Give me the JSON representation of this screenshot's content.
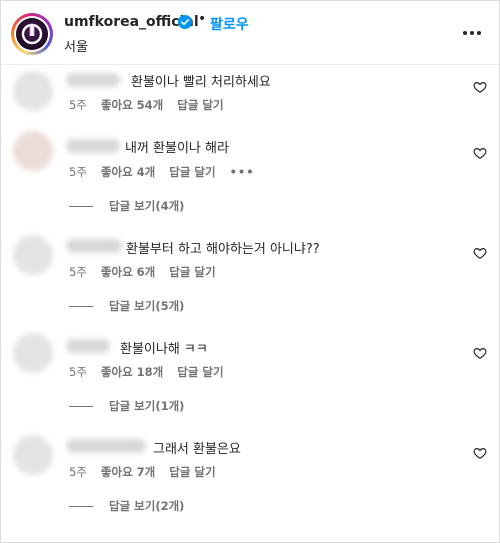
{
  "header": {
    "username": "umfkorea_official",
    "separator": "•",
    "follow_label": "팔로우",
    "location": "서울"
  },
  "comments": [
    {
      "text": "환불이나 빨리 처리하세요",
      "time": "5주",
      "likes": "좋아요 54개",
      "reply": "답글 달기"
    },
    {
      "text": "내꺼 환불이나 해라",
      "time": "5주",
      "likes": "좋아요 4개",
      "reply": "답글 달기",
      "more": "•••",
      "view_replies": "답글 보기(4개)"
    },
    {
      "text": "환불부터 하고 해야하는거 아니냐??",
      "time": "5주",
      "likes": "좋아요 6개",
      "reply": "답글 달기",
      "view_replies": "답글 보기(5개)"
    },
    {
      "text": "환불이나해 ㅋㅋ",
      "time": "5주",
      "likes": "좋아요 18개",
      "reply": "답글 달기",
      "view_replies": "답글 보기(1개)"
    },
    {
      "text": "그래서 환불은요",
      "time": "5주",
      "likes": "좋아요 7개",
      "reply": "답글 달기",
      "view_replies": "답글 보기(2개)"
    }
  ],
  "colors": {
    "accent": "#0095f6",
    "verified": "#0095f6",
    "text": "#262626",
    "muted": "#737373"
  }
}
